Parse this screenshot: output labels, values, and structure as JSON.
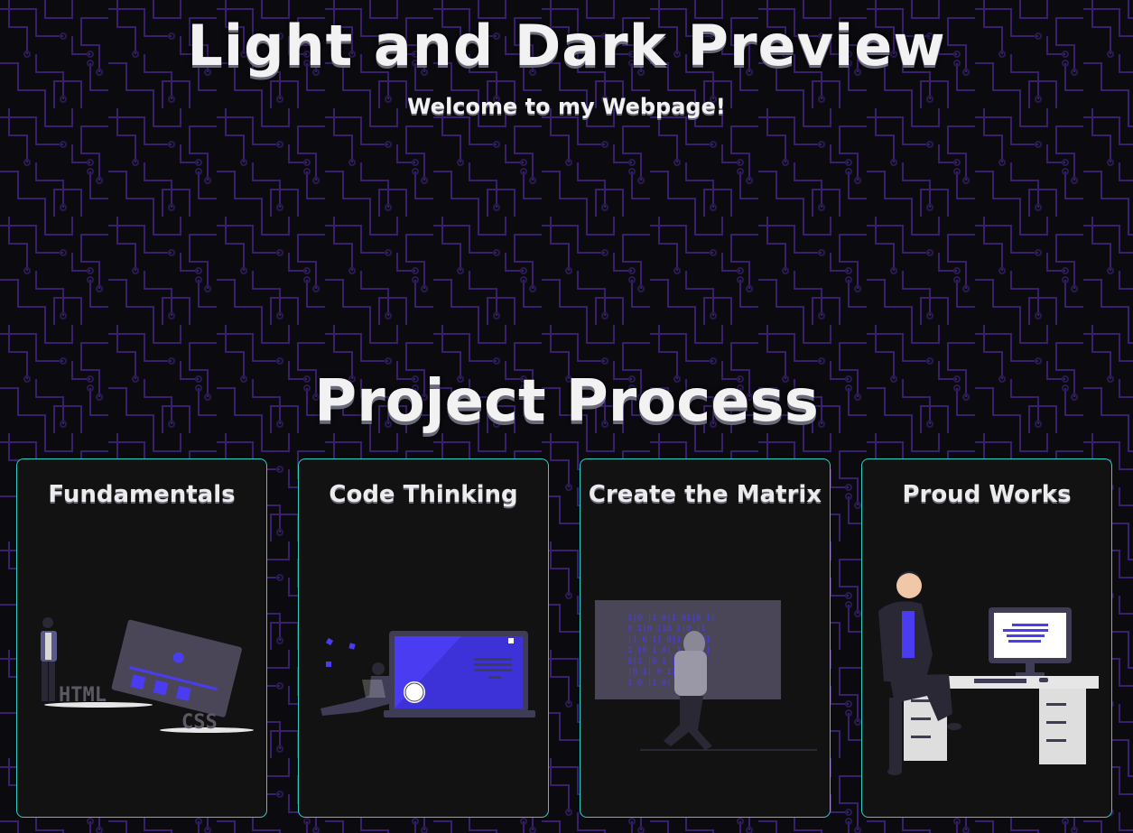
{
  "header": {
    "title": "Light and Dark Preview",
    "subtitle": "Welcome to my Webpage!"
  },
  "projects": {
    "heading": "Project Process",
    "cards": [
      {
        "title": "Fundamentals",
        "illustration": "html-css-illustration"
      },
      {
        "title": "Code Thinking",
        "illustration": "laptop-thinking-illustration"
      },
      {
        "title": "Create the Matrix",
        "illustration": "matrix-hacker-illustration"
      },
      {
        "title": "Proud Works",
        "illustration": "desk-workstation-illustration"
      }
    ],
    "illustration_labels": {
      "html": "HTML",
      "css": "CSS"
    }
  },
  "colors": {
    "background": "#0a0a0f",
    "circuit": "#3a1f6e",
    "card_border": "#2fd1c4",
    "card_bg": "#121212",
    "accent": "#4a3cf0"
  }
}
